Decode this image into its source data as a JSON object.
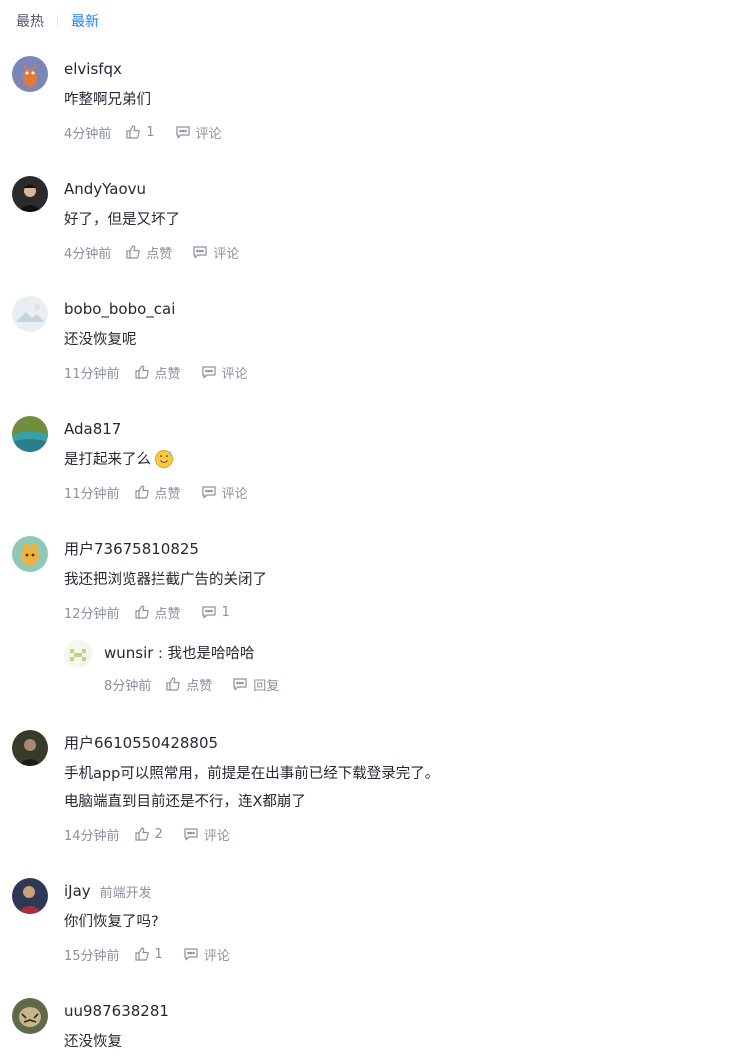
{
  "tabs": {
    "hot": "最热",
    "latest": "最新"
  },
  "comments": [
    {
      "username": "elvisfqx",
      "text": "咋整啊兄弟们",
      "time": "4分钟前",
      "like": "1",
      "comment": "评论"
    },
    {
      "username": "AndyYaovu",
      "text": "好了，但是又坏了",
      "time": "4分钟前",
      "like": "点赞",
      "comment": "评论"
    },
    {
      "username": "bobo_bobo_cai",
      "text": "还没恢复呢",
      "time": "11分钟前",
      "like": "点赞",
      "comment": "评论"
    },
    {
      "username": "Ada817",
      "text": "是打起来了么",
      "time": "11分钟前",
      "like": "点赞",
      "comment": "评论"
    },
    {
      "username": "用户73675810825",
      "text": "我还把浏览器拦截广告的关闭了",
      "time": "12分钟前",
      "like": "点赞",
      "comment": "1",
      "reply": {
        "username": "wunsir",
        "separator": " : ",
        "text": "我也是哈哈哈",
        "time": "8分钟前",
        "like": "点赞",
        "reply_label": "回复"
      }
    },
    {
      "username": "用户6610550428805",
      "text_line1": "手机app可以照常用，前提是在出事前已经下载登录完了。",
      "text_line2": "电脑端直到目前还是不行，连X都崩了",
      "time": "14分钟前",
      "like": "2",
      "comment": "评论"
    },
    {
      "username": "iJay",
      "job": "前端开发",
      "text": "你们恢复了吗?",
      "time": "15分钟前",
      "like": "1",
      "comment": "评论"
    },
    {
      "username": "uu987638281",
      "text": "还没恢复"
    }
  ],
  "icons": {
    "like": "thumbs-up-icon",
    "comment": "comment-bubble-icon",
    "emoji": "sweat-smile-emoji"
  },
  "colors": {
    "accent": "#1e80ff",
    "meta": "#8a919f",
    "text": "#252933"
  }
}
